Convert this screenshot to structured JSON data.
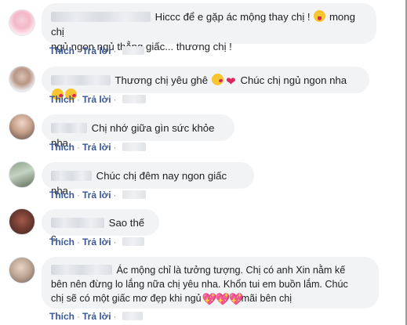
{
  "labels": {
    "like": "Thích",
    "reply": "Trả lời",
    "separator": "·"
  },
  "comments": [
    {
      "avatar": "avatar-icon",
      "segments": [
        "Hiccc để e gặp ác mộng thay chị !",
        "mong chị",
        "ngủ ngon ngủ thẳng giấc... thương chị !"
      ],
      "emojis": [
        "tongue-emoji"
      ]
    },
    {
      "avatar": "avatar-icon",
      "segments": [
        "Thương chị yêu ghê",
        "Chúc chị ngủ ngon nha"
      ],
      "emojis": [
        "kiss-emoji",
        "heart-emoji",
        "kiss-emoji",
        "kiss-emoji"
      ]
    },
    {
      "avatar": "avatar-icon",
      "segments": [
        "Chị nhớ giữa gìn sức khỏe nha."
      ]
    },
    {
      "avatar": "avatar-icon",
      "segments": [
        "Chúc chị đêm nay ngon giấc nha"
      ]
    },
    {
      "avatar": "avatar-icon",
      "segments": [
        "Sao thế c"
      ]
    },
    {
      "avatar": "avatar-icon",
      "segments": [
        "Ác mộng chỉ là tưởng tượng. Chị có anh Xin nằm kế",
        "bên nên đừng lo lắng nữa chị yêu nha. Khổn tui em buồn lắm. Chúc",
        "chị sẽ có một giấc mơ đẹp khi ngủ",
        "mãi bên chị"
      ],
      "emojis": [
        "sparkle-heart-emoji",
        "sparkle-heart-emoji",
        "sparkle-heart-emoji"
      ]
    }
  ],
  "colors": {
    "bubble": "#f2f3f5",
    "link": "#385898",
    "text": "#1c1e21"
  }
}
